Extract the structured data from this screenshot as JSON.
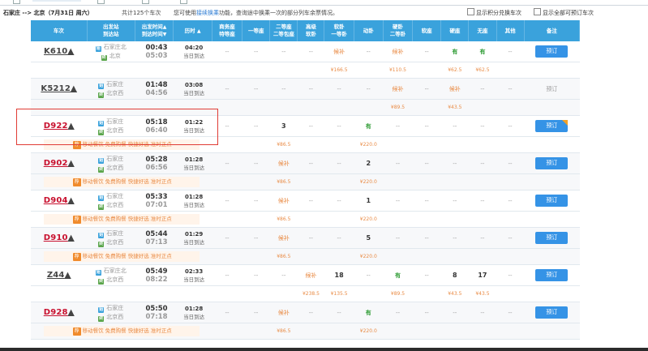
{
  "summary": {
    "route": "石家庄 --> 北京（7月31日 周六）",
    "count": "共计125个车次",
    "tip_prefix": "您可使用",
    "tip_link": "接续换乘",
    "tip_suffix": "功能，查询途中换乘一次的部分列车余票情况。",
    "opt_points": "显示积分兑换车次",
    "opt_all": "显示全部可预订车次"
  },
  "headers": {
    "train": "车次",
    "stations_l1": "出发站",
    "stations_l2": "到达站",
    "times_l1": "出发时间",
    "times_l2": "到达时间",
    "duration": "历时",
    "business_l1": "商务座",
    "business_l2": "特等座",
    "first": "一等座",
    "second_l1": "二等座",
    "second_l2": "二等包座",
    "premium_l1": "高级",
    "premium_l2": "软卧",
    "soft_l1": "软卧",
    "soft_l2": "一等卧",
    "moving": "动卧",
    "hard_l1": "硬卧",
    "hard_l2": "二等卧",
    "soft_seat": "软座",
    "hard_seat": "硬座",
    "no_seat": "无座",
    "other": "其他",
    "remark": "备注"
  },
  "icons": {
    "from": "始",
    "to": "终",
    "promo_badge": "荐",
    "sort_up": "▲",
    "sort_down": "▼",
    "expand": "▲"
  },
  "rows": [
    {
      "train": "K610",
      "red": false,
      "from": "石家庄北",
      "to": "北京",
      "dep": "00:43",
      "arr": "05:03",
      "dur": "04:20",
      "arrive_day": "当日到达",
      "seats": [
        "--",
        "--",
        "--",
        "--",
        "候补",
        "--",
        "候补",
        "--",
        "有",
        "有",
        "--"
      ],
      "book": "预订",
      "book_enabled": true,
      "prices": [
        "",
        "",
        "",
        "",
        "¥166.5",
        "",
        "¥110.5",
        "",
        "¥62.5",
        "¥62.5",
        ""
      ],
      "promo": ""
    },
    {
      "train": "K5212",
      "red": false,
      "from": "石家庄",
      "to": "北京西",
      "dep": "01:48",
      "arr": "04:56",
      "dur": "03:08",
      "arrive_day": "当日到达",
      "seats": [
        "--",
        "--",
        "--",
        "--",
        "--",
        "--",
        "候补",
        "--",
        "候补",
        "--",
        "--"
      ],
      "book": "预订",
      "book_enabled": false,
      "prices": [
        "",
        "",
        "",
        "",
        "",
        "",
        "¥89.5",
        "",
        "¥43.5",
        "",
        ""
      ],
      "promo": ""
    },
    {
      "train": "D922",
      "red": true,
      "from": "石家庄",
      "to": "北京西",
      "dep": "05:18",
      "arr": "06:40",
      "dur": "01:22",
      "arrive_day": "当日到达",
      "seats": [
        "--",
        "--",
        "3",
        "--",
        "--",
        "有",
        "--",
        "--",
        "--",
        "--",
        "--"
      ],
      "book": "预订",
      "book_enabled": true,
      "prices": [
        "",
        "",
        "¥86.5",
        "",
        "",
        "¥220.0",
        "",
        "",
        "",
        "",
        ""
      ],
      "promo": "移动餐饮 免费购餐 快捷好选 准时正点"
    },
    {
      "train": "D902",
      "red": true,
      "from": "石家庄",
      "to": "北京西",
      "dep": "05:28",
      "arr": "06:56",
      "dur": "01:28",
      "arrive_day": "当日到达",
      "seats": [
        "--",
        "--",
        "候补",
        "--",
        "--",
        "2",
        "--",
        "--",
        "--",
        "--",
        "--"
      ],
      "book": "预订",
      "book_enabled": true,
      "prices": [
        "",
        "",
        "¥86.5",
        "",
        "",
        "¥220.0",
        "",
        "",
        "",
        "",
        ""
      ],
      "promo": "移动餐饮 免费购餐 快捷好选 准时正点"
    },
    {
      "train": "D904",
      "red": true,
      "from": "石家庄",
      "to": "北京西",
      "dep": "05:33",
      "arr": "07:01",
      "dur": "01:28",
      "arrive_day": "当日到达",
      "seats": [
        "--",
        "--",
        "候补",
        "--",
        "--",
        "1",
        "--",
        "--",
        "--",
        "--",
        "--"
      ],
      "book": "预订",
      "book_enabled": true,
      "prices": [
        "",
        "",
        "¥86.5",
        "",
        "",
        "¥220.0",
        "",
        "",
        "",
        "",
        ""
      ],
      "promo": "移动餐饮 免费购餐 快捷好选 准时正点"
    },
    {
      "train": "D910",
      "red": true,
      "from": "石家庄",
      "to": "北京西",
      "dep": "05:44",
      "arr": "07:13",
      "dur": "01:29",
      "arrive_day": "当日到达",
      "seats": [
        "--",
        "--",
        "候补",
        "--",
        "--",
        "5",
        "--",
        "--",
        "--",
        "--",
        "--"
      ],
      "book": "预订",
      "book_enabled": true,
      "prices": [
        "",
        "",
        "¥86.5",
        "",
        "",
        "¥220.0",
        "",
        "",
        "",
        "",
        ""
      ],
      "promo": "移动餐饮 免费购餐 快捷好选 准时正点"
    },
    {
      "train": "Z44",
      "red": false,
      "from": "石家庄北",
      "to": "北京西",
      "dep": "05:49",
      "arr": "08:22",
      "dur": "02:33",
      "arrive_day": "当日到达",
      "seats": [
        "--",
        "--",
        "--",
        "候补",
        "18",
        "--",
        "有",
        "--",
        "8",
        "17",
        "--"
      ],
      "book": "预订",
      "book_enabled": true,
      "prices": [
        "",
        "",
        "",
        "¥238.5",
        "¥135.5",
        "",
        "¥89.5",
        "",
        "¥43.5",
        "¥43.5",
        ""
      ],
      "promo": ""
    },
    {
      "train": "D928",
      "red": true,
      "from": "石家庄",
      "to": "北京西",
      "dep": "05:50",
      "arr": "07:18",
      "dur": "01:28",
      "arrive_day": "当日到达",
      "seats": [
        "--",
        "--",
        "候补",
        "--",
        "--",
        "有",
        "--",
        "--",
        "--",
        "--",
        "--"
      ],
      "book": "预订",
      "book_enabled": true,
      "prices": [
        "",
        "",
        "¥86.5",
        "",
        "",
        "¥220.0",
        "",
        "",
        "",
        "",
        ""
      ],
      "promo": "移动餐饮 免费购餐 快捷好选 准时正点"
    }
  ]
}
